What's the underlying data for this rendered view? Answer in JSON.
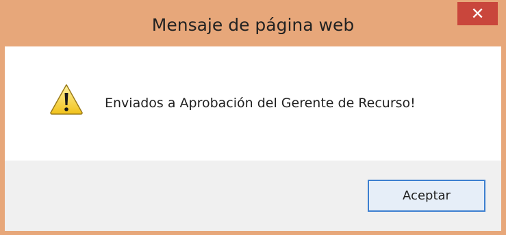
{
  "dialog": {
    "title": "Mensaje de página web",
    "close_label": "✕",
    "message": "Enviados a Aprobación del Gerente de Recurso!",
    "icon": "warning-icon",
    "ok_label": "Aceptar"
  },
  "colors": {
    "titlebar": "#e7a77a",
    "close_button": "#c9463c",
    "ok_border": "#3c7fd0"
  }
}
